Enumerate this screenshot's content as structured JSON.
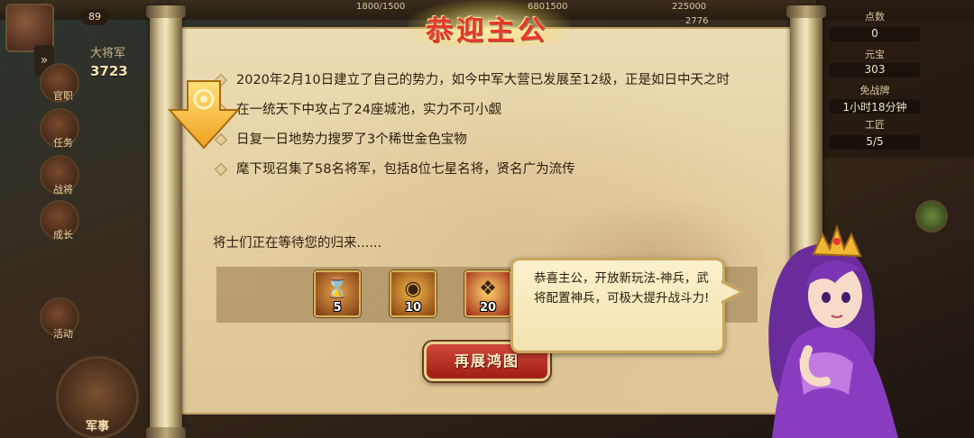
{
  "title": "恭迎主公",
  "achievements": [
    "2020年2月10日建立了自己的势力，如今中军大营已发展至12级，正是如日中天之时",
    "在一统天下中攻占了24座城池，实力不可小觑",
    "日复一日地势力搜罗了3个稀世金色宝物",
    "麾下现召集了58名将军，包括8位七星名将，贤名广为流传"
  ],
  "waiting_text": "将士们正在等待您的归来......",
  "rewards": [
    {
      "icon": "hourglass-icon",
      "count": "5"
    },
    {
      "icon": "golden-orb-icon",
      "count": "10"
    },
    {
      "icon": "treasure-icon",
      "count": "20"
    }
  ],
  "cta_label": "再展鸿图",
  "speech_bubble": {
    "text": "恭喜主公，开放新玩法-神兵，武将配置神兵，可极大提升战斗力!"
  },
  "background": {
    "level": "89",
    "power_label": "大将军",
    "power_value": "3723",
    "resource_a": "1800/1500",
    "resource_b": "6801500",
    "resource_c": "225000",
    "resource_d": "2776",
    "left_menu": [
      "官职",
      "任务",
      "战将",
      "成长",
      "活动"
    ],
    "military_label": "军事",
    "right_labels": [
      "点数",
      "元宝",
      "免战牌",
      "工匠"
    ],
    "right_values": [
      "0",
      "303",
      "1小时18分钟",
      "5/5"
    ]
  },
  "colors": {
    "title_red": "#e7382a",
    "cta_red": "#c0352a",
    "paper": "#e6d2a6",
    "bubble_border": "#c9a75e"
  }
}
